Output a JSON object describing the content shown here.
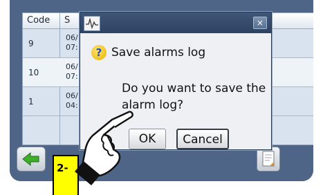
{
  "table": {
    "header_code": "Code",
    "header_partial": "S",
    "rows": [
      {
        "code": "9",
        "date": "06/\n07:"
      },
      {
        "code": "10",
        "date": "06/\n07:"
      },
      {
        "code": "1",
        "date": "06/\n04:"
      }
    ]
  },
  "dialog": {
    "close_glyph": "×",
    "title": "Save alarms log",
    "message": "Do you want to save the alarm log?",
    "ok_label": "OK",
    "cancel_label": "Cancel",
    "help_glyph": "?"
  },
  "annotations": {
    "step_label": "2-"
  },
  "colors": {
    "screen_bg": "#4f6587",
    "titlebar": "#2e4362",
    "callout": "#ffff00"
  },
  "icons": {
    "title_app": "waveform-icon",
    "back": "green-arrow-left-icon",
    "export": "document-icon",
    "pointer": "pointing-hand-icon"
  }
}
